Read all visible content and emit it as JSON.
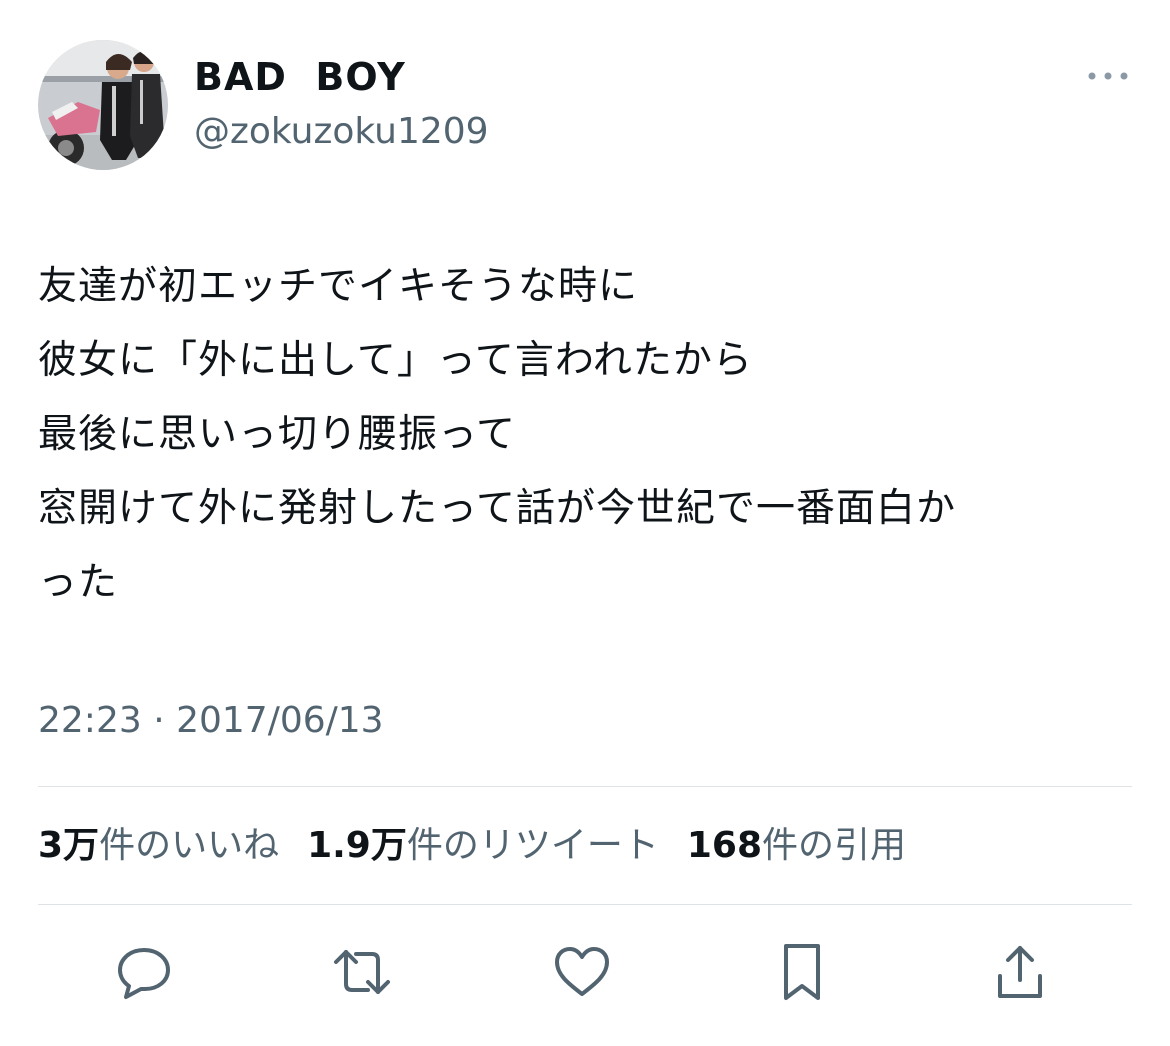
{
  "tweet": {
    "display_name": "BAD  BOY",
    "handle": "@zokuzoku1209",
    "text_lines": [
      "友達が初エッチでイキそうな時に",
      "彼女に「外に出して」って言われたから",
      "最後に思いっ切り腰振って",
      "窓開けて外に発射したって話が今世紀で一番面白か",
      "った"
    ],
    "timestamp": "22:23 · 2017/06/13"
  },
  "stats": {
    "likes_num": "3万",
    "likes_label": "件のいいね",
    "retweets_num": "1.9万",
    "retweets_label": "件のリツイート",
    "quotes_num": "168",
    "quotes_label": "件の引用"
  },
  "icons": {
    "more": "more-icon",
    "reply": "reply-icon",
    "retweet": "retweet-icon",
    "like": "heart-icon",
    "bookmark": "bookmark-icon",
    "share": "share-icon"
  },
  "colors": {
    "text": "#0f1419",
    "secondary": "#536471",
    "divider": "#dfe3e6"
  }
}
